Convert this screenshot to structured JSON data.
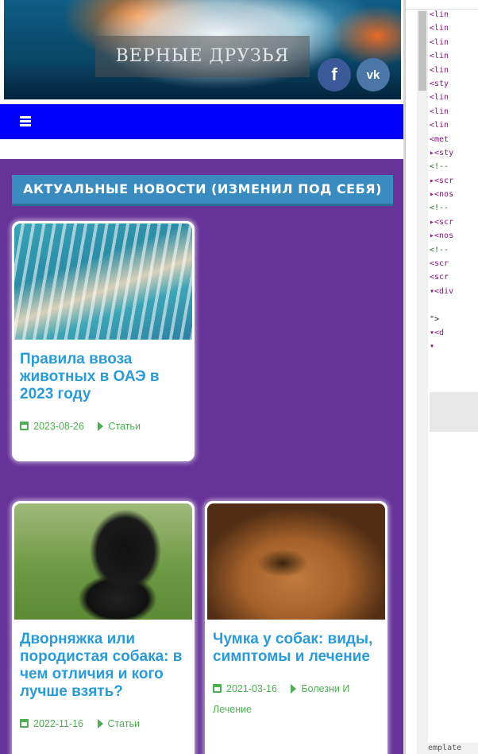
{
  "site": {
    "title": "ВЕРНЫЕ ДРУЗЬЯ",
    "social": {
      "facebook": "f",
      "vk": "vk"
    },
    "section_heading": "АКТУАЛЬНЫЕ НОВОСТИ (ИЗМЕНИЛ ПОД СЕБЯ)",
    "posts": [
      {
        "title": "Правила ввоза животных в ОАЭ в 2023 году",
        "date": "2023-08-26",
        "category": "Статьи",
        "image": "dubai-aerial"
      },
      {
        "title": "Дворняжка или породистая собака: в чем отличия и кого лучше взять?",
        "date": "2022-11-16",
        "category": "Статьи",
        "image": "black-dog-paw"
      },
      {
        "title": "Чумка у собак: виды, симптомы и лечение",
        "date": "2021-03-16",
        "category": "Болезни И Лечение",
        "image": "beagle-face"
      }
    ]
  },
  "devtools": {
    "lines": [
      "<lin",
      "<lin",
      "<lin",
      "<lin",
      "<lin",
      "<sty",
      "<lin",
      "<lin",
      "<lin",
      "<met",
      "▸<sty",
      "<!--",
      "▸<scr",
      "▸<nos",
      "<!--",
      "▸<scr",
      "▸<nos",
      "<!--",
      "<scr",
      "<scr",
      "▾<div",
      "",
      "\">",
      "▾<d",
      "▾"
    ],
    "bottom_text": "emplate"
  },
  "colors": {
    "menubar": "#0000ff",
    "content_bg": "#663399",
    "heading_bg": "#3a8bbf",
    "title_link": "#2b9bd8",
    "meta_green": "#4caf50"
  }
}
